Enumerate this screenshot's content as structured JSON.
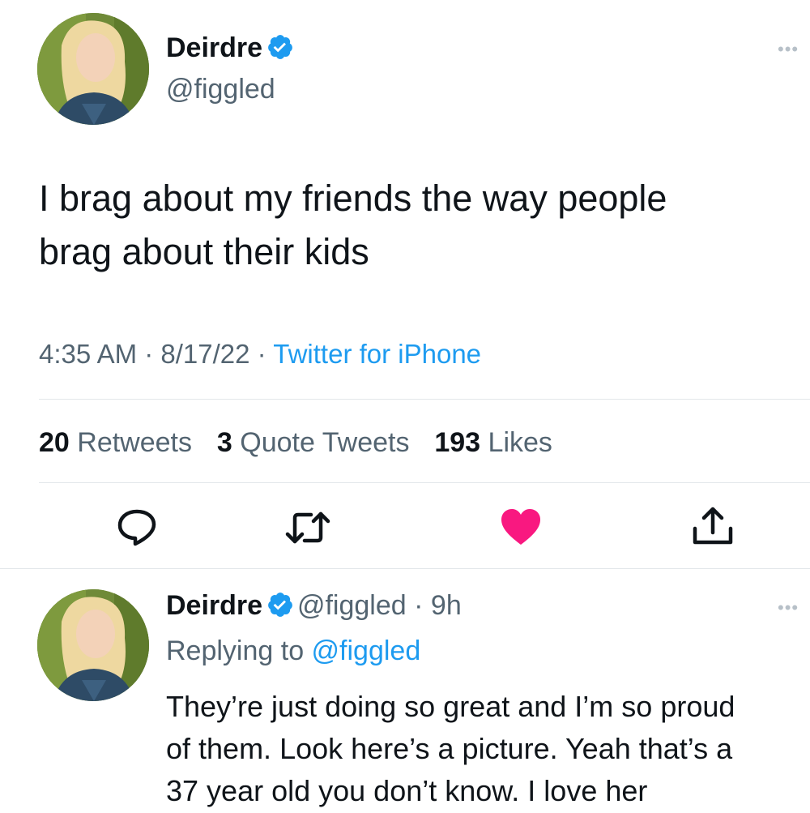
{
  "tweet": {
    "author_name": "Deirdre",
    "author_handle": "@figgled",
    "more_icon": "more-dots-icon",
    "text_line1": "I brag about my friends the way people",
    "text_line2": "brag about their kids",
    "time": "4:35 AM",
    "sep1": " · ",
    "date": "8/17/22",
    "sep2": " · ",
    "source": "Twitter for iPhone",
    "stats": {
      "retweets_count": "20",
      "retweets_label": " Retweets",
      "quotes_count": "3",
      "quotes_label": " Quote Tweets",
      "likes_count": "193",
      "likes_label": " Likes"
    },
    "actions": [
      "reply-icon",
      "retweet-icon",
      "heart-icon",
      "share-icon"
    ]
  },
  "reply": {
    "author_name": "Deirdre",
    "author_handle": "@figgled",
    "time_sep": " · ",
    "time": "9h",
    "replying_prefix": "Replying to ",
    "replying_handle": "@figgled",
    "text_line1": "They’re just doing so great and I’m so proud",
    "text_line2": "of them. Look here’s a picture. Yeah that’s a",
    "text_line3": "37 year old you don’t know. I love her"
  },
  "colors": {
    "link": "#1d9bf0",
    "verified": "#1d9bf0",
    "like": "#f91880",
    "muted": "#536471"
  }
}
